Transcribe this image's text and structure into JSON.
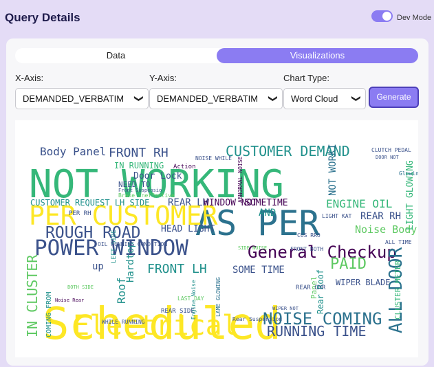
{
  "header": {
    "title": "Query Details",
    "dev_mode_label": "Dev Mode",
    "dev_mode_on": true,
    "accent_color": "#8b7cf2"
  },
  "tabs": [
    {
      "label": "Data",
      "active": false
    },
    {
      "label": "Visualizations",
      "active": true
    }
  ],
  "controls": {
    "x_axis": {
      "label": "X-Axis:",
      "value": "DEMANDED_VERBATIM"
    },
    "y_axis": {
      "label": "Y-Axis:",
      "value": "DEMANDED_VERBATIM"
    },
    "chart_type": {
      "label": "Chart Type:",
      "value": "Word Cloud"
    },
    "generate_label": "Generate",
    "chevron_icon": "chevron-down-icon"
  },
  "wordcloud": {
    "palette": [
      "#21918c",
      "#fde725",
      "#3b528b",
      "#440154",
      "#5ec962",
      "#2c728e",
      "#35b779"
    ],
    "words": [
      {
        "text": "Scheduled",
        "c": 1
      },
      {
        "text": "NOT WORKING",
        "c": 6
      },
      {
        "text": "AS PER",
        "c": 5
      },
      {
        "text": "PER CUSTOMER",
        "c": 1
      },
      {
        "text": "POWER WINDOW",
        "c": 2
      },
      {
        "text": "Electrical",
        "c": 1
      },
      {
        "text": "General Checkup",
        "c": 3
      },
      {
        "text": "ROUGH ROAD",
        "c": 2
      },
      {
        "text": "CUSTOMER DEMAND",
        "c": 0
      },
      {
        "text": "NOISE COMING",
        "c": 5
      },
      {
        "text": "RUNNING TIME",
        "c": 2
      },
      {
        "text": "FRONT LH",
        "c": 0
      },
      {
        "text": "FRONT RH",
        "c": 2
      },
      {
        "text": "Body Panel",
        "c": 2
      },
      {
        "text": "PAID",
        "c": 4
      },
      {
        "text": "IN CLUSTER",
        "c": 4
      },
      {
        "text": "CUSTOMER REQUEST LH SIDE",
        "c": 0
      },
      {
        "text": "REAR LH",
        "c": 2
      },
      {
        "text": "WINDOW NOT",
        "c": 3
      },
      {
        "text": "SOMETIME",
        "c": 3
      },
      {
        "text": "ENGINE OIL",
        "c": 6
      },
      {
        "text": "REAR RH",
        "c": 2
      },
      {
        "text": "HEAD LIGHT",
        "c": 2
      },
      {
        "text": "Hardtop",
        "c": 0
      },
      {
        "text": "Roof",
        "c": 0
      },
      {
        "text": "SOME TIME",
        "c": 2
      },
      {
        "text": "ALL DOOR",
        "c": 5
      },
      {
        "text": "IN RUNNING",
        "c": 6
      },
      {
        "text": "Door Lock",
        "c": 2
      },
      {
        "text": "Noise Body",
        "c": 4
      },
      {
        "text": "LIGHT GLOWING",
        "c": 6
      },
      {
        "text": "up",
        "c": 2
      },
      {
        "text": "AND",
        "c": 0
      },
      {
        "text": "NOT WORKI",
        "c": 5
      },
      {
        "text": "CLUSTER METER",
        "c": 6
      },
      {
        "text": "NEED TO",
        "c": 2
      },
      {
        "text": "WIPER BLADE",
        "c": 2
      },
      {
        "text": "FRONT BOTH",
        "c": 2
      },
      {
        "text": "Action",
        "c": 3
      },
      {
        "text": "COMING FROM",
        "c": 0
      },
      {
        "text": "ABNORMAL NOISE",
        "c": 3
      },
      {
        "text": "REAR SIDE",
        "c": 2
      },
      {
        "text": "Rear Suspension",
        "c": 2
      },
      {
        "text": "WHILE RUNNING",
        "c": 2
      },
      {
        "text": "Rear Roof",
        "c": 0
      },
      {
        "text": "Panel",
        "c": 4
      },
      {
        "text": "CLUTCH PEDAL",
        "c": 2
      },
      {
        "text": "NOISE WHILE",
        "c": 2
      },
      {
        "text": "Brake ineffective",
        "c": 4
      },
      {
        "text": "Front Suspensio",
        "c": 2
      },
      {
        "text": "LEFT SIDE",
        "c": 0
      },
      {
        "text": "OIL RUNNING CONDITION",
        "c": 2
      },
      {
        "text": "SIDE NOISE",
        "c": 4
      },
      {
        "text": "BOTH SIDE",
        "c": 4
      },
      {
        "text": "Glowing To",
        "c": 5
      },
      {
        "text": "LAST DAY",
        "c": 4
      },
      {
        "text": "PER RH",
        "c": 2
      },
      {
        "text": "REAR CHR",
        "c": 2
      },
      {
        "text": "CUS RRO",
        "c": 2
      },
      {
        "text": "LIGHT KAT",
        "c": 2
      },
      {
        "text": "Noise Rear",
        "c": 3
      },
      {
        "text": "DOOR NOT",
        "c": 2
      },
      {
        "text": "WIPER NOT",
        "c": 2
      },
      {
        "text": "LAME GLOWING",
        "c": 5
      },
      {
        "text": "ALL TIME",
        "c": 2
      },
      {
        "text": "Engine Noise",
        "c": 0
      }
    ]
  }
}
